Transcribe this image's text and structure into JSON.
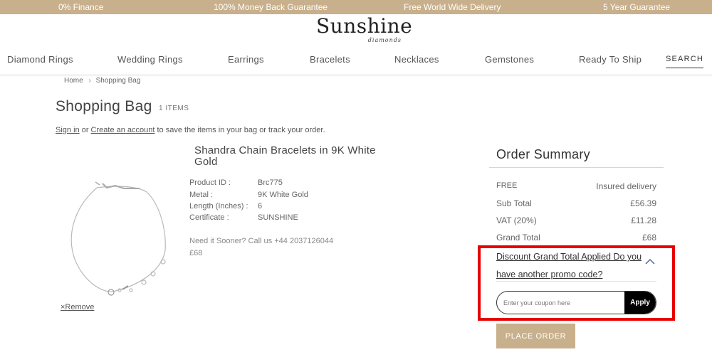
{
  "topbar": {
    "items": [
      "0% Finance",
      "100% Money Back Guarantee",
      "Free World Wide Delivery",
      "5 Year Guarantee"
    ]
  },
  "logo": {
    "word": "Sunshine",
    "sub": "diamonds"
  },
  "nav": {
    "items": [
      "Diamond Rings",
      "Wedding Rings",
      "Earrings",
      "Bracelets",
      "Necklaces",
      "Gemstones",
      "Ready To Ship"
    ],
    "search": "SEARCH"
  },
  "breadcrumb": {
    "home": "Home",
    "current": "Shopping Bag"
  },
  "page": {
    "title": "Shopping Bag",
    "items_count": "1 ITEMS",
    "signin": "Sign in",
    "or": "or",
    "create_account": "Create an account",
    "signin_suffix": "to save the items in your bag or track your order."
  },
  "product": {
    "name": "Shandra Chain Bracelets in 9K White Gold",
    "specs": [
      {
        "label": "Product ID :",
        "value": "Brc775"
      },
      {
        "label": "Metal :",
        "value": "9K White Gold"
      },
      {
        "label": "Length (Inches) :",
        "value": "6"
      },
      {
        "label": "Certificate :",
        "value": "SUNSHINE"
      }
    ],
    "need_sooner": "Need it Sooner? Call us +44 2037126044",
    "price": "£68",
    "remove": "×Remove"
  },
  "summary": {
    "title": "Order Summary",
    "rows": [
      {
        "label": "FREE",
        "value": "Insured delivery"
      },
      {
        "label": "Sub Total",
        "value": "£56.39"
      },
      {
        "label": "VAT (20%)",
        "value": "£11.28"
      },
      {
        "label": "Grand Total",
        "value": "£68"
      }
    ],
    "discount_text": "Discount Grand Total Applied Do you have another promo code?",
    "coupon_placeholder": "Enter your coupon here",
    "apply_label": "Apply",
    "place_order": "PLACE ORDER"
  },
  "colors": {
    "accent": "#c8b08c",
    "highlight": "#e60000",
    "button_dark": "#000000"
  }
}
